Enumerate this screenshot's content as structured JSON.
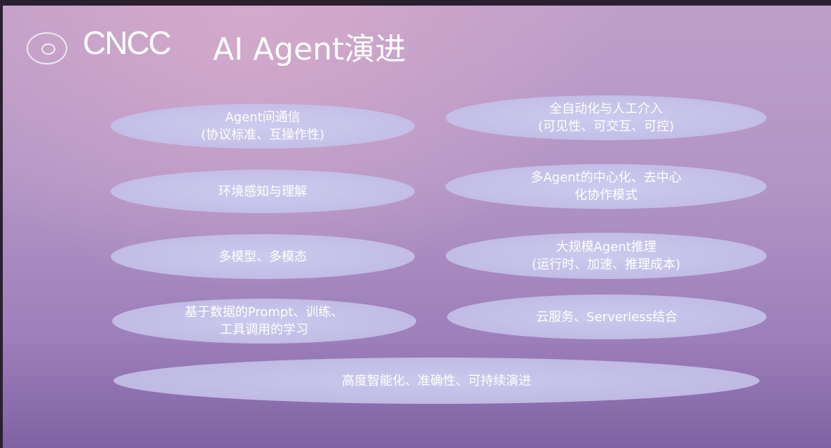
{
  "header": {
    "logo_text": "CNCC logo",
    "brand": "CNCC",
    "title": "AI Agent演进"
  },
  "items": [
    "Agent间通信\n(协议标准、互操作性)",
    "全自动化与人工介入\n(可见性、可交互、可控)",
    "环境感知与理解",
    "多Agent的中心化、去中心\n化协作模式",
    "多模型、多模态",
    "大规模Agent推理\n(运行时、加速、推理成本)",
    "基于数据的Prompt、训练、\n工具调用的学习",
    "云服务、Serverless结合",
    "高度智能化、准确性、可持续演进"
  ]
}
